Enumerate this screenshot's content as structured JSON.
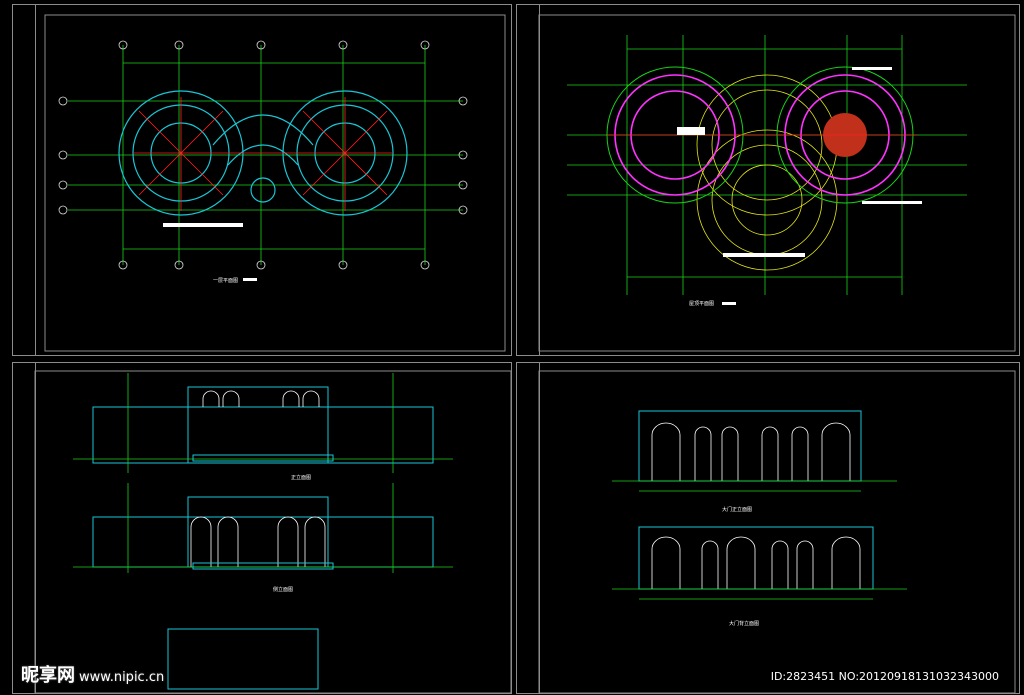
{
  "sheets": {
    "top_left": {
      "caption_label": "一层平面图"
    },
    "top_right": {
      "caption_label": "屋顶平面图"
    },
    "bottom_left": {
      "caption_front": "正立面图",
      "caption_side": "侧立面图"
    },
    "bottom_right": {
      "caption_top": "大门正立面图",
      "caption_bottom": "大门背立面图"
    }
  },
  "watermark": {
    "brand": "昵享网",
    "url": "www.nipic.cn"
  },
  "image_id": "ID:2823451 NO:20120918131032343000",
  "colors": {
    "green": "#1bd11b",
    "cyan": "#19c6d6",
    "red": "#ff2222",
    "magenta": "#ff33ff",
    "yellow": "#e7e71a",
    "white": "#ffffff",
    "border": "#8c8c8c"
  }
}
